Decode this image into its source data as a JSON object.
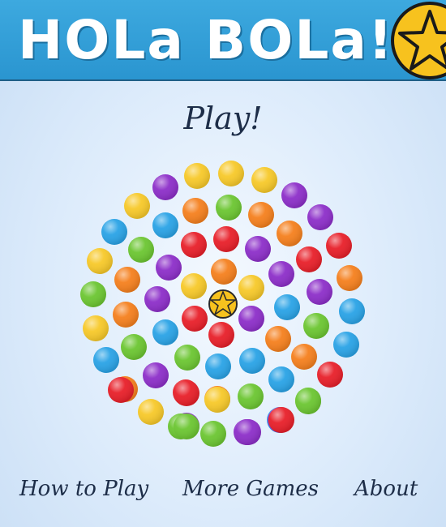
{
  "header": {
    "title": "HOLa BOLa!",
    "star_icon": "star-icon"
  },
  "main": {
    "play_label": "Play!"
  },
  "nav": {
    "how_to_play": "How to Play",
    "more_games": "More Games",
    "about": "About"
  },
  "colors": {
    "red": "#e8202a",
    "orange": "#f5801e",
    "yellow": "#f7c92a",
    "green": "#6cc632",
    "blue": "#2aa3e6",
    "purple": "#8d2fc9",
    "star": "#f7c21e"
  },
  "board": {
    "center_icon": "star-icon",
    "ball_colors": [
      "yellow",
      "yellow",
      "yellow",
      "purple",
      "purple",
      "yellow",
      "orange",
      "green",
      "orange",
      "purple",
      "blue",
      "blue",
      "orange",
      "green",
      "purple",
      "red",
      "yellow",
      "red",
      "red",
      "purple",
      "orange",
      "yellow",
      "red",
      "purple",
      "orange",
      "purple",
      "orange",
      "green",
      "yellow",
      "purple",
      "green",
      "blue",
      "orange",
      "blue",
      "orange",
      "yellow",
      "purple",
      "blue",
      "red",
      "blue",
      "orange",
      "blue",
      "red",
      "red",
      "purple",
      "orange",
      "blue",
      "green",
      "blue",
      "green",
      "purple",
      "green",
      "blue",
      "green",
      "red",
      "orange",
      "blue",
      "red",
      "purple",
      "green",
      "purple",
      "yellow",
      "green",
      "red",
      "red",
      "yellow",
      "green",
      "green",
      "purple",
      "red"
    ]
  }
}
